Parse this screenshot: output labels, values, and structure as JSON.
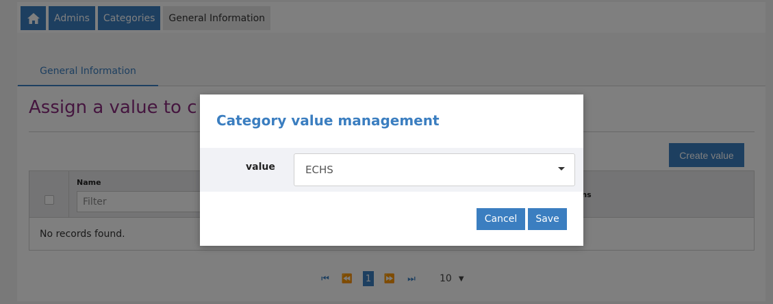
{
  "breadcrumb": {
    "home_icon": "home-icon",
    "items": [
      "Admins",
      "Categories",
      "General Information"
    ]
  },
  "tabs": [
    "General Information"
  ],
  "page": {
    "title": "Assign a value to c",
    "create_button": "Create value"
  },
  "table": {
    "columns": {
      "name": "Name",
      "actions": "ions"
    },
    "filter_placeholder": "Filter",
    "empty_message": "No records found."
  },
  "pagination": {
    "first_icon": "first-page-icon",
    "prev_icon": "prev-page-icon",
    "next_icon": "next-page-icon",
    "last_icon": "last-page-icon",
    "current_page": "1",
    "page_size": "10"
  },
  "modal": {
    "title": "Category value management",
    "field_label": "value",
    "field_value": "ECHS",
    "cancel_label": "Cancel",
    "save_label": "Save"
  },
  "colors": {
    "accent": "#3b7ec0",
    "title_purple": "#8a2c7f"
  }
}
